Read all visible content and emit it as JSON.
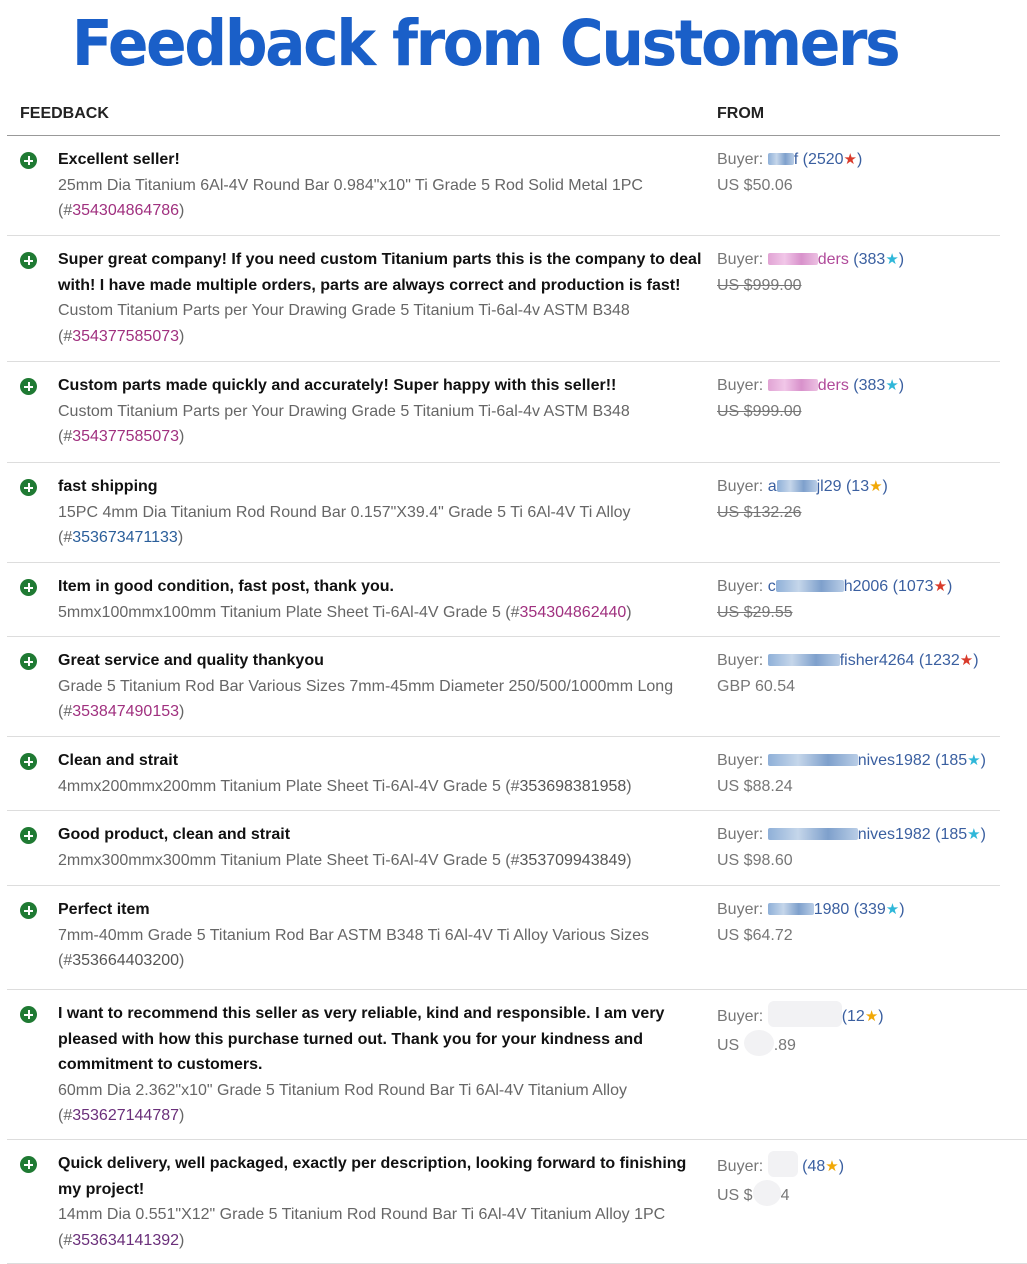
{
  "banner": {
    "title": "Feedback from Customers"
  },
  "header": {
    "feedback_label": "FEEDBACK",
    "from_label": "FROM"
  },
  "colors": {
    "banner": "#1a5fc8",
    "plus_icon": "#1f7a33",
    "link_purple": "#a0307f",
    "link_blue": "#2a5e9a",
    "star_red": "#d93b2b",
    "star_teal": "#2fb7d9",
    "star_yellow": "#f1a806"
  },
  "rows": [
    {
      "comment": "Excellent seller!",
      "item": "25mm Dia Titanium 6Al-4V Round Bar 0.984\"x10\" Ti Grade 5 Rod Solid Metal 1PC",
      "item_id": "354304864786",
      "buyer_label": "Buyer:",
      "buyer_visible": "f",
      "score": "2520",
      "price": "US $50.06",
      "price_struck": false
    },
    {
      "comment": "Super great company! If you need custom Titanium parts this is the company to deal with! I have made multiple orders, parts are always correct and production is fast!",
      "item": "Custom Titanium Parts per Your Drawing Grade 5 Titanium Ti-6al-4v ASTM B348",
      "item_id": "354377585073",
      "buyer_label": "Buyer:",
      "buyer_visible": "ders",
      "score": "383",
      "price": "US $999.00",
      "price_struck": true
    },
    {
      "comment": "Custom parts made quickly and accurately! Super happy with this seller!!",
      "item": "Custom Titanium Parts per Your Drawing Grade 5 Titanium Ti-6al-4v ASTM B348",
      "item_id": "354377585073",
      "buyer_label": "Buyer:",
      "buyer_visible": "ders",
      "score": "383",
      "price": "US $999.00",
      "price_struck": true
    },
    {
      "comment": "fast shipping",
      "item": "15PC 4mm Dia Titanium Rod Round Bar 0.157\"X39.4\" Grade 5 Ti 6Al-4V Ti Alloy",
      "item_id": "353673471133",
      "buyer_label": "Buyer:",
      "buyer_visible_prefix": "a",
      "buyer_visible": "jl29",
      "score": "13",
      "price": "US $132.26",
      "price_struck": true
    },
    {
      "comment": "Item in good condition, fast post, thank you.",
      "item": "5mmx100mmx100mm Titanium Plate Sheet Ti-6Al-4V Grade 5",
      "item_id": "354304862440",
      "buyer_label": "Buyer:",
      "buyer_visible_prefix": "c",
      "buyer_visible": "h2006",
      "score": "1073",
      "price": "US $29.55",
      "price_struck": true
    },
    {
      "comment": "Great service and quality thankyou",
      "item": "Grade 5 Titanium Rod Bar Various Sizes 7mm-45mm Diameter 250/500/1000mm Long",
      "item_id": "353847490153",
      "buyer_label": "Buyer:",
      "buyer_visible": "fisher4264",
      "score": "1232",
      "price": "GBP 60.54",
      "price_struck": false
    },
    {
      "comment": "Clean and strait",
      "item": "4mmx200mmx200mm Titanium Plate Sheet Ti-6Al-4V Grade 5",
      "item_id": "353698381958",
      "buyer_label": "Buyer:",
      "buyer_visible": "nives1982",
      "score": "185",
      "price": "US $88.24",
      "price_struck": false
    },
    {
      "comment": "Good product, clean and strait",
      "item": "2mmx300mmx300mm Titanium Plate Sheet Ti-6Al-4V Grade 5",
      "item_id": "353709943849",
      "buyer_label": "Buyer:",
      "buyer_visible": "nives1982",
      "score": "185",
      "price": "US $98.60",
      "price_struck": false
    },
    {
      "comment": "Perfect item",
      "item": "7mm-40mm Grade 5 Titanium Rod Bar ASTM B348 Ti 6Al-4V Ti Alloy Various Sizes",
      "item_id": "353664403200",
      "buyer_label": "Buyer:",
      "buyer_visible": "1980",
      "score": "339",
      "price": "US $64.72",
      "price_struck": false
    },
    {
      "comment": "I want to recommend this seller as very reliable, kind and responsible. I am very pleased with how this purchase turned out. Thank you for your kindness and commitment to customers.",
      "item": "60mm Dia 2.362\"x10\" Grade 5 Titanium Rod Round Bar Ti 6Al-4V Titanium Alloy",
      "item_id": "353627144787",
      "buyer_label": "Buyer:",
      "buyer_visible": "",
      "score": "12",
      "price_prefix": "US",
      "price": ".89",
      "price_struck": false
    },
    {
      "comment": "Quick delivery, well packaged, exactly per description, looking forward to finishing my project!",
      "item": "14mm Dia 0.551\"X12\" Grade 5 Titanium Rod Round Bar Ti 6Al-4V Titanium Alloy 1PC",
      "item_id": "353634141392",
      "buyer_label": "Buyer:",
      "buyer_visible": "",
      "score": "48",
      "price_prefix": "US $",
      "price": "4",
      "price_struck": false
    }
  ]
}
